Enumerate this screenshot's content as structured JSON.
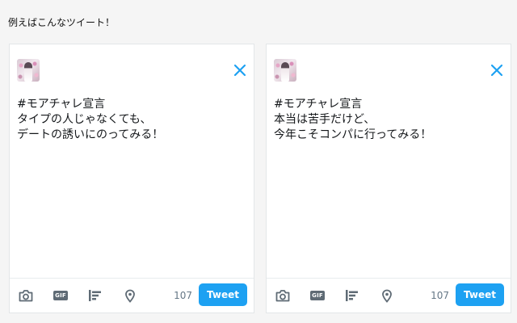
{
  "caption": "例えばこんなツイート！",
  "compose_boxes": [
    {
      "text": "#モアチャレ宣言\nタイプの人じゃなくても、\nデートの誘いにのってみる！",
      "char_count": "107",
      "tweet_label": "Tweet",
      "gif_label": "GIF"
    },
    {
      "text": "#モアチャレ宣言\n本当は苦手だけど、\n今年こそコンパに行ってみる！",
      "char_count": "107",
      "tweet_label": "Tweet",
      "gif_label": "GIF"
    }
  ],
  "icons": {
    "close": "close-icon",
    "camera": "camera-icon",
    "gif": "gif-icon",
    "poll": "poll-icon",
    "location": "location-pin-icon",
    "avatar": "avatar"
  },
  "colors": {
    "accent": "#1da1f2",
    "icon_gray": "#5f6b75",
    "counter_gray": "#657786",
    "background": "#f5f5f5"
  }
}
